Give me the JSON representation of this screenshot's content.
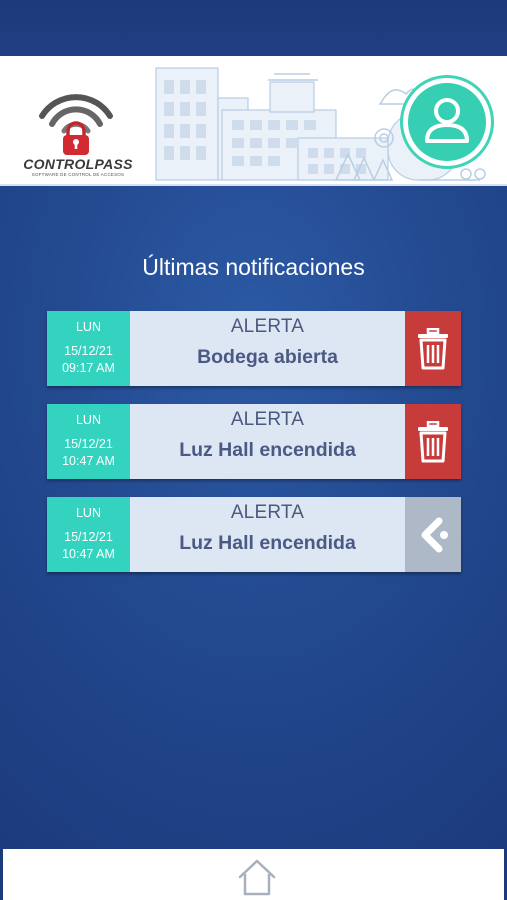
{
  "header": {
    "logo_text": "CONTROLPASS",
    "logo_subtitle": "SOFTWARE DE CONTROL DE ACCESOS",
    "avatar_icon": "user-icon"
  },
  "page_title": "Últimas notificaciones",
  "notifications": [
    {
      "day": "LUN",
      "date": "15/12/21",
      "time": "09:17 AM",
      "type": "ALERTA",
      "message": "Bodega abierta",
      "action_icon": "trash-icon"
    },
    {
      "day": "LUN",
      "date": "15/12/21",
      "time": "10:47 AM",
      "type": "ALERTA",
      "message": "Luz Hall encendida",
      "action_icon": "trash-icon"
    },
    {
      "day": "LUN",
      "date": "15/12/21",
      "time": "10:47 AM",
      "type": "ALERTA",
      "message": "Luz Hall encendida",
      "action_icon": "back-arrow-icon"
    }
  ],
  "footer": {
    "home_icon": "home-icon"
  },
  "colors": {
    "background": "#1e3f85",
    "accent_teal": "#33d3bf",
    "card_bg": "#dde6f3",
    "delete_red": "#c83b3b",
    "back_gray": "#aeb9c8",
    "text_dark": "#4a5a84"
  }
}
